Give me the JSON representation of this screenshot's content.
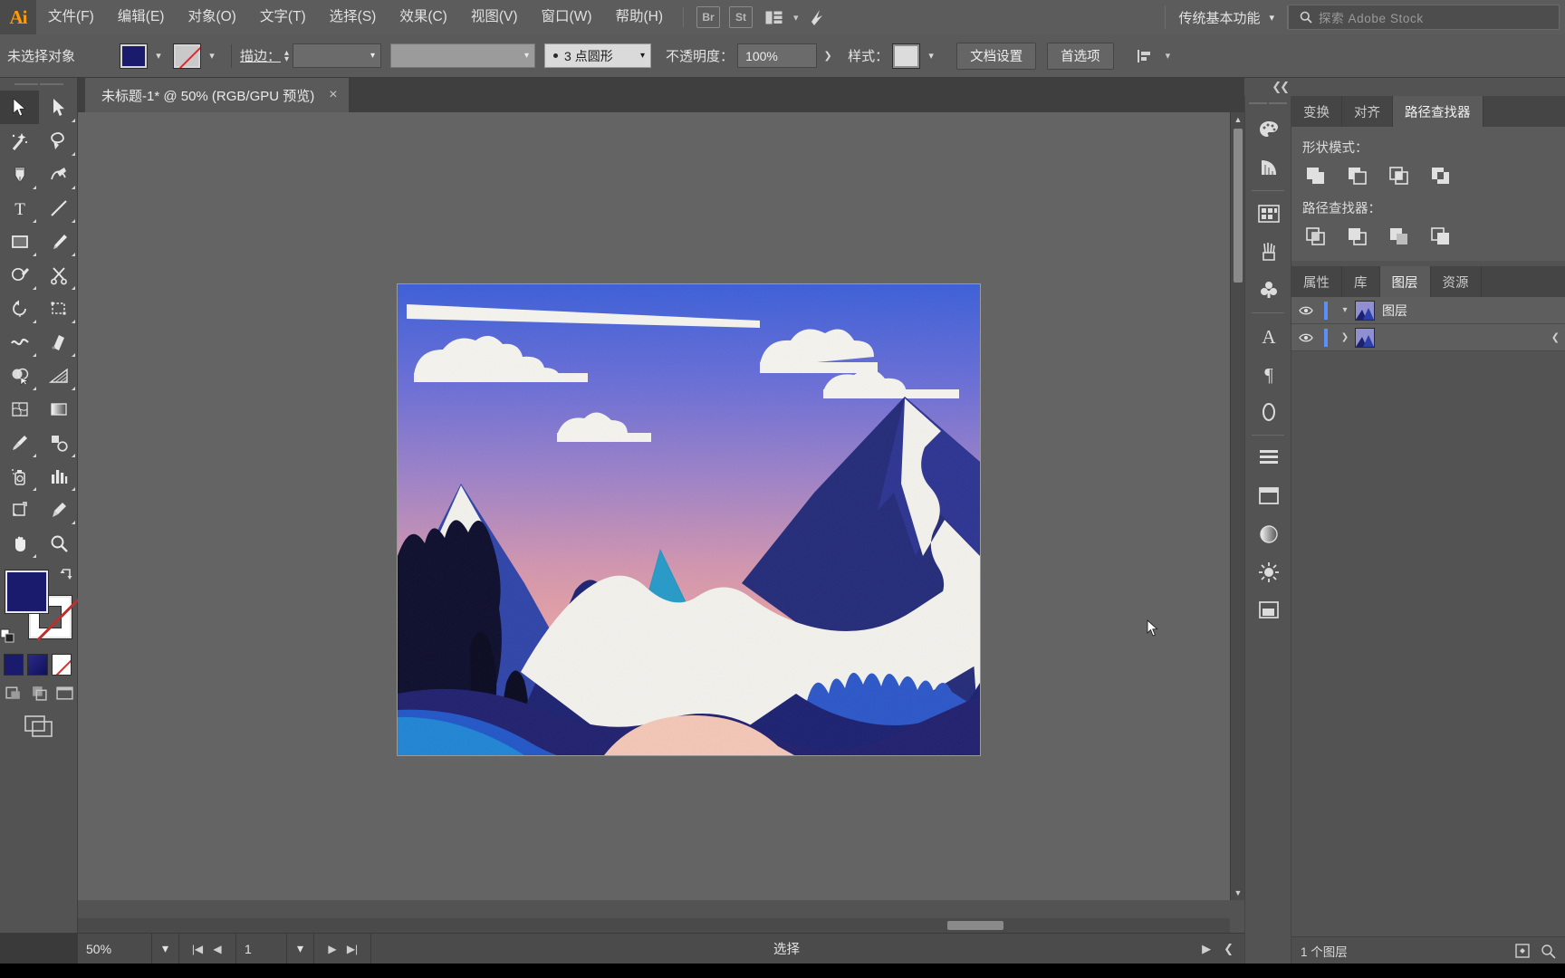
{
  "app": {
    "name": "Adobe Illustrator",
    "logo": "Ai"
  },
  "menubar": {
    "items": [
      {
        "label": "文件(F)",
        "name": "menu-file"
      },
      {
        "label": "编辑(E)",
        "name": "menu-edit"
      },
      {
        "label": "对象(O)",
        "name": "menu-object"
      },
      {
        "label": "文字(T)",
        "name": "menu-type"
      },
      {
        "label": "选择(S)",
        "name": "menu-select"
      },
      {
        "label": "效果(C)",
        "name": "menu-effect"
      },
      {
        "label": "视图(V)",
        "name": "menu-view"
      },
      {
        "label": "窗口(W)",
        "name": "menu-window"
      },
      {
        "label": "帮助(H)",
        "name": "menu-help"
      }
    ],
    "bridge_label": "Br",
    "stock_label": "St",
    "arrange_label": "arrange-documents-icon",
    "workspace": "传统基本功能",
    "search_placeholder": "探索 Adobe Stock"
  },
  "controlbar": {
    "selection_status": "未选择对象",
    "fill_color": "#1b1b6e",
    "stroke_color": "none",
    "stroke_label": "描边：",
    "stroke_weight": "",
    "stroke_profile": "",
    "brush_definition": "3 点圆形",
    "opacity_label": "不透明度：",
    "opacity_value": "100%",
    "style_label": "样式：",
    "doc_setup": "文档设置",
    "preferences": "首选项"
  },
  "toolbar": {
    "tools": [
      {
        "name": "selection-tool",
        "label": "选择工具",
        "active": true
      },
      {
        "name": "direct-selection-tool",
        "label": "直接选择工具",
        "active": false
      },
      {
        "name": "magic-wand-tool",
        "label": "魔棒工具",
        "active": false
      },
      {
        "name": "lasso-tool",
        "label": "套索工具",
        "active": false
      },
      {
        "name": "pen-tool",
        "label": "钢笔工具",
        "active": false
      },
      {
        "name": "curvature-tool",
        "label": "曲率工具",
        "active": false
      },
      {
        "name": "type-tool",
        "label": "文字工具",
        "active": false
      },
      {
        "name": "line-segment-tool",
        "label": "直线段工具",
        "active": false
      },
      {
        "name": "rectangle-tool",
        "label": "矩形工具",
        "active": false
      },
      {
        "name": "paintbrush-tool",
        "label": "画笔工具",
        "active": false
      },
      {
        "name": "shaper-tool",
        "label": "Shaper 工具",
        "active": false
      },
      {
        "name": "scissors-tool",
        "label": "剪刀工具",
        "active": false
      },
      {
        "name": "rotate-tool",
        "label": "旋转工具",
        "active": false
      },
      {
        "name": "scale-tool",
        "label": "比例缩放工具",
        "active": false
      },
      {
        "name": "width-tool",
        "label": "宽度工具",
        "active": false
      },
      {
        "name": "free-transform-tool",
        "label": "自由变换工具",
        "active": false
      },
      {
        "name": "shape-builder-tool",
        "label": "形状生成器工具",
        "active": false
      },
      {
        "name": "perspective-grid-tool",
        "label": "透视网格工具",
        "active": false
      },
      {
        "name": "mesh-tool",
        "label": "网格工具",
        "active": false
      },
      {
        "name": "gradient-tool",
        "label": "渐变工具",
        "active": false
      },
      {
        "name": "eyedropper-tool",
        "label": "吸管工具",
        "active": false
      },
      {
        "name": "blend-tool",
        "label": "混合工具",
        "active": false
      },
      {
        "name": "symbol-sprayer-tool",
        "label": "符号喷枪工具",
        "active": false
      },
      {
        "name": "column-graph-tool",
        "label": "柱形图工具",
        "active": false
      },
      {
        "name": "artboard-tool",
        "label": "画板工具",
        "active": false
      },
      {
        "name": "slice-tool",
        "label": "切片工具",
        "active": false
      },
      {
        "name": "hand-tool",
        "label": "抓手工具",
        "active": false
      },
      {
        "name": "zoom-tool",
        "label": "缩放工具",
        "active": false
      }
    ],
    "fill": "#1b1b6e",
    "stroke": "none",
    "draw_modes": [
      "正常绘图",
      "背面绘图",
      "内部绘图"
    ],
    "screen_mode": "更改屏幕模式"
  },
  "document": {
    "tab_title": "未标题-1* @ 50% (RGB/GPU 预览)",
    "close_label": "×",
    "zoom": "50%",
    "artboard_number": "1",
    "status_text": "选择"
  },
  "statusbar": {
    "zoom": "50%",
    "artboard": "1",
    "tool_status": "选择"
  },
  "panels": {
    "top_tabs": [
      {
        "label": "变换",
        "name": "tab-transform",
        "active": false
      },
      {
        "label": "对齐",
        "name": "tab-align",
        "active": false
      },
      {
        "label": "路径查找器",
        "name": "tab-pathfinder",
        "active": true
      }
    ],
    "pathfinder": {
      "shape_modes_label": "形状模式：",
      "shape_modes": [
        "联集",
        "减去顶层",
        "交集",
        "差集"
      ],
      "pathfinders_label": "路径查找器：",
      "pathfinders": [
        "分割",
        "修边",
        "合并",
        "裁剪"
      ]
    },
    "bottom_tabs": [
      {
        "label": "属性",
        "name": "tab-properties",
        "active": false
      },
      {
        "label": "库",
        "name": "tab-libraries",
        "active": false
      },
      {
        "label": "图层",
        "name": "tab-layers",
        "active": true
      },
      {
        "label": "资源",
        "name": "tab-assets",
        "active": false
      }
    ],
    "layers": {
      "rows": [
        {
          "name": "图层",
          "selected": true,
          "color": "#5b8ff9",
          "expandable": false
        },
        {
          "name": "",
          "selected": false,
          "color": "#5b8ff9",
          "expandable": true
        }
      ],
      "footer_count": "1 个图层"
    }
  },
  "icon_dock": {
    "icons": [
      {
        "name": "color-palette-icon"
      },
      {
        "name": "color-guide-icon"
      },
      {
        "name": "swatches-icon"
      },
      {
        "name": "brushes-icon"
      },
      {
        "name": "symbols-icon"
      },
      {
        "name": "character-icon"
      },
      {
        "name": "paragraph-icon"
      },
      {
        "name": "opentype-icon"
      },
      {
        "name": "align-panel-icon"
      },
      {
        "name": "artboards-icon"
      },
      {
        "name": "gradient-icon"
      },
      {
        "name": "appearance-icon"
      },
      {
        "name": "transparency-icon"
      }
    ]
  },
  "artwork": {
    "title": "山脉风景插画",
    "colors": {
      "sky_top": "#3e5fd6",
      "sky_mid": "#8f7fd0",
      "sky_bottom": "#eca39e",
      "sky_low": "#f0b0a6",
      "cloud": "#f5f3ee",
      "mountain_dark": "#0d0d33",
      "mountain_navy": "#1c2270",
      "mountain_blue": "#2c3f9e",
      "mountain_mid": "#3350b5",
      "peak_teal": "#1f94c4",
      "snow": "#f2f1ec",
      "foreground_blue": "#1f7fd0",
      "foreground_deep": "#2559c9",
      "valley_pink": "#f2c4b5",
      "tree_dark": "#07071f"
    }
  }
}
